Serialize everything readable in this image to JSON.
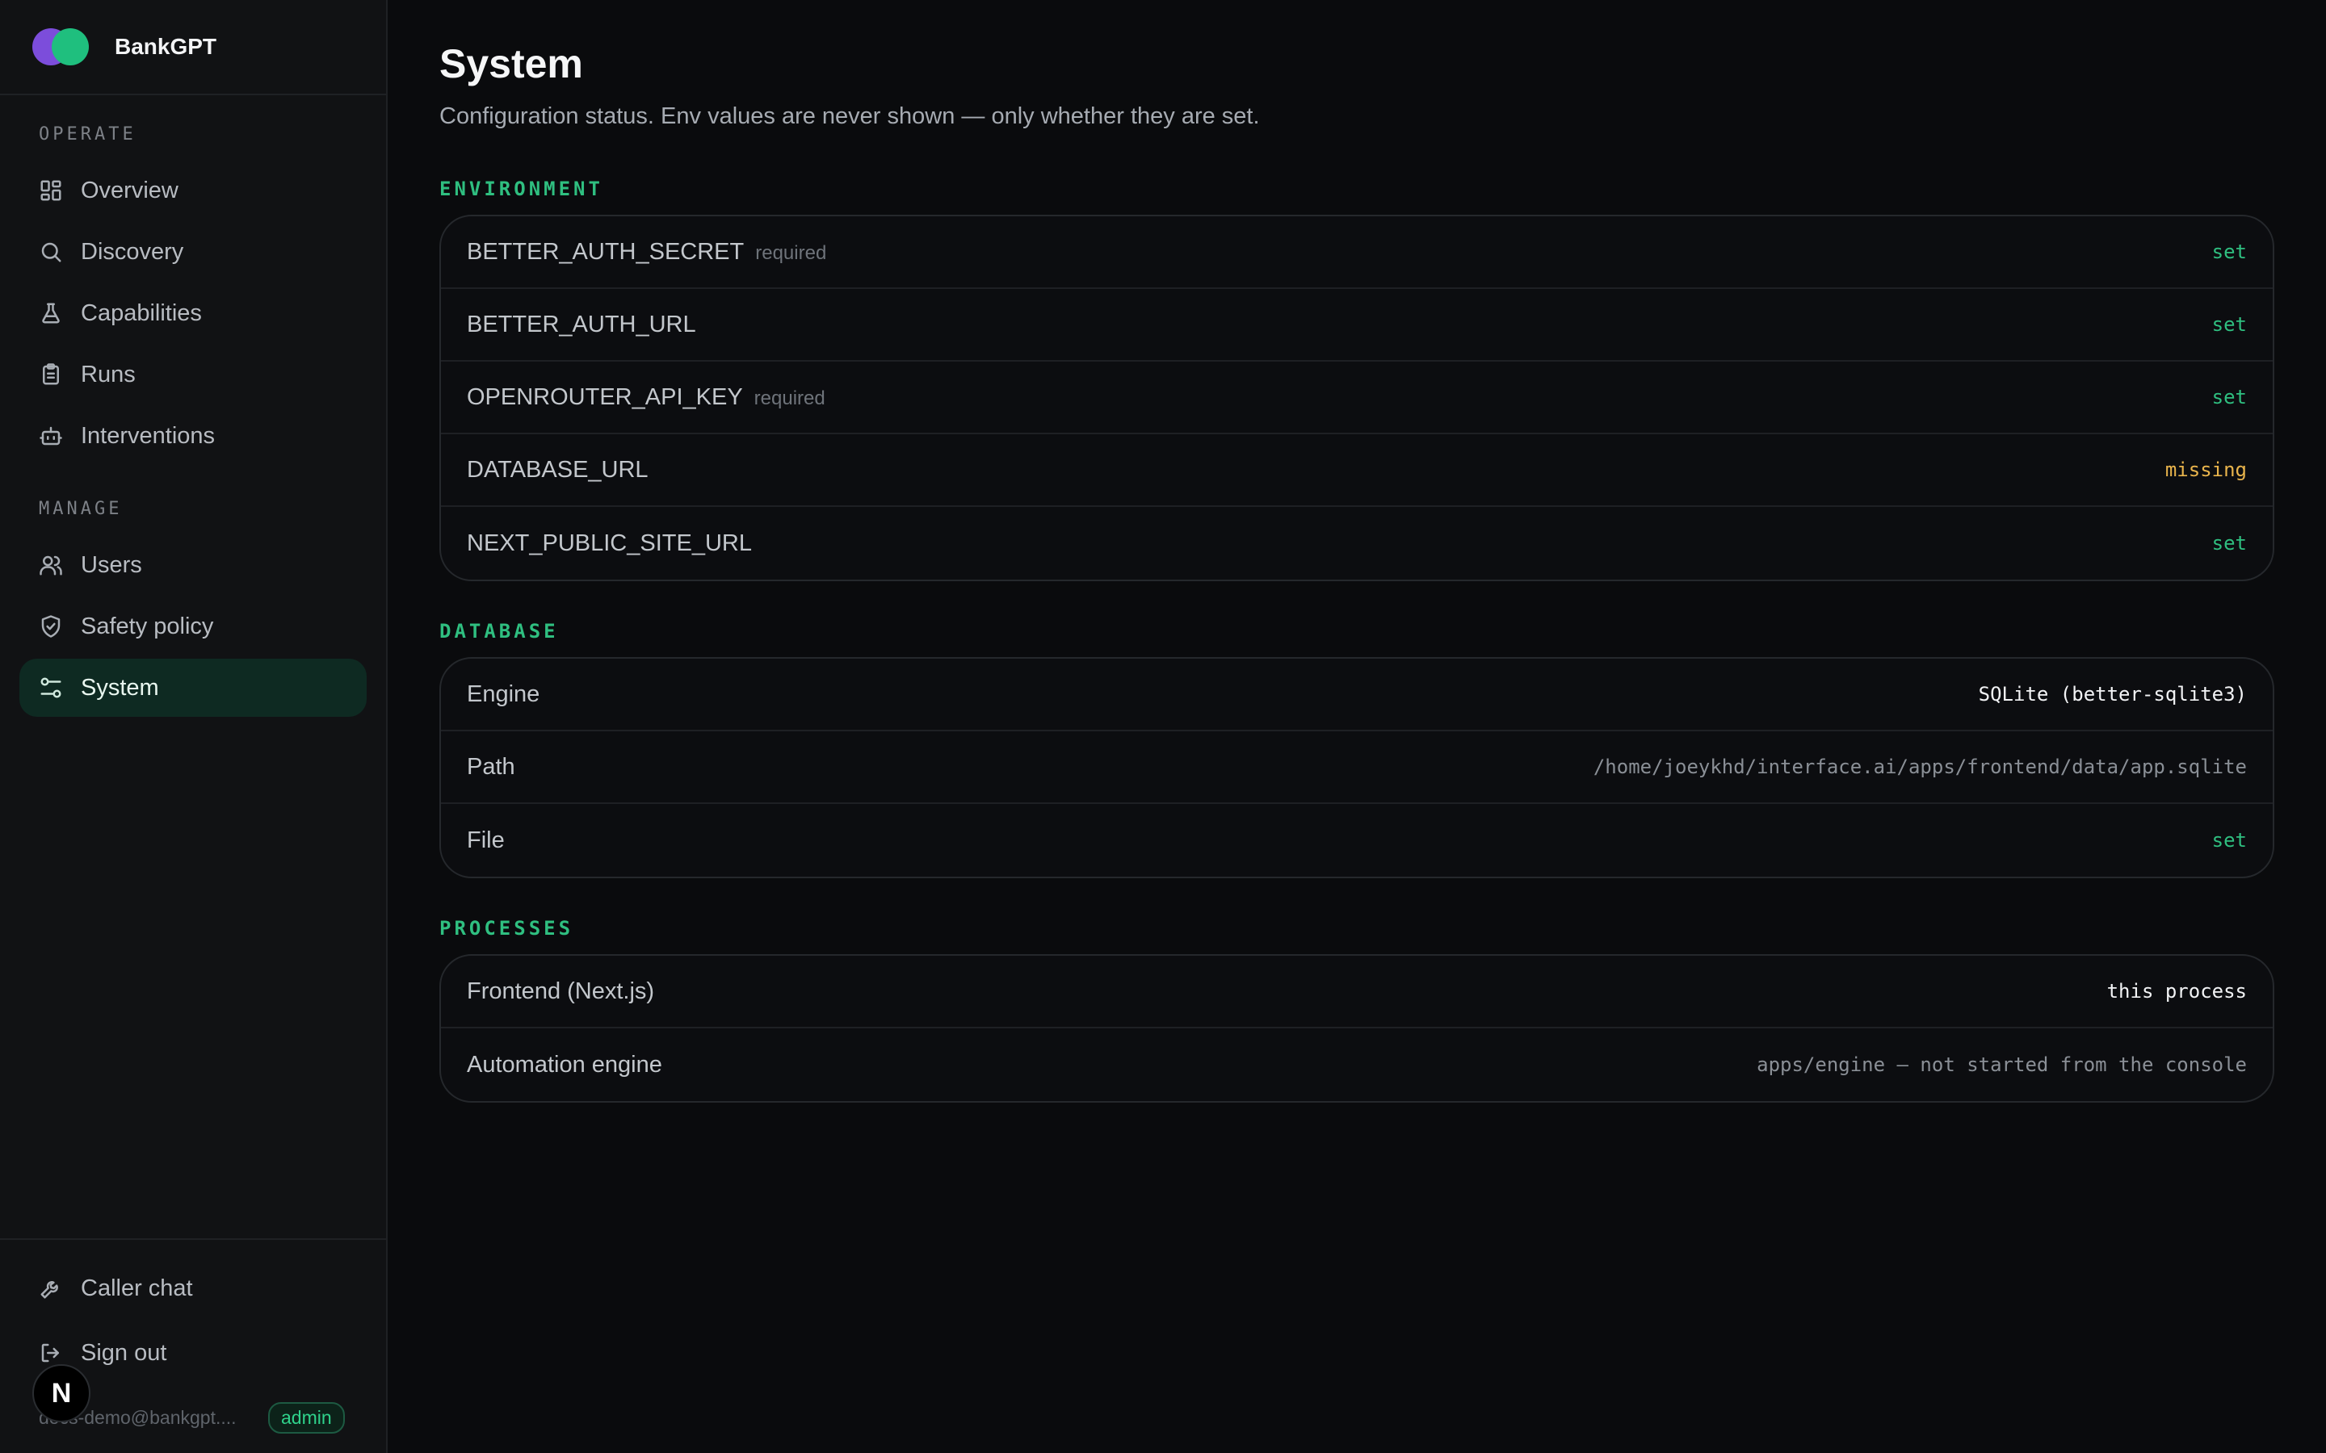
{
  "brand": {
    "name": "BankGPT",
    "colors": {
      "primary": "#7c4ddb",
      "secondary": "#1fbf7e"
    }
  },
  "sidebar": {
    "sections": [
      {
        "label": "OPERATE",
        "items": [
          {
            "label": "Overview",
            "icon": "grid-icon"
          },
          {
            "label": "Discovery",
            "icon": "search-icon"
          },
          {
            "label": "Capabilities",
            "icon": "flask-icon"
          },
          {
            "label": "Runs",
            "icon": "clipboard-icon"
          },
          {
            "label": "Interventions",
            "icon": "bot-icon"
          }
        ]
      },
      {
        "label": "MANAGE",
        "items": [
          {
            "label": "Users",
            "icon": "users-icon"
          },
          {
            "label": "Safety policy",
            "icon": "shield-check-icon"
          },
          {
            "label": "System",
            "icon": "sliders-icon",
            "active": true
          }
        ]
      }
    ],
    "footer": {
      "caller_chat": "Caller chat",
      "sign_out": "Sign out",
      "user_email": "docs-demo@bankgpt....",
      "role_badge": "admin",
      "n_badge": "N"
    }
  },
  "page": {
    "title": "System",
    "description": "Configuration status. Env values are never shown — only whether they are set."
  },
  "environment": {
    "label": "ENVIRONMENT",
    "rows": [
      {
        "key": "BETTER_AUTH_SECRET",
        "tag": "required",
        "value": "set"
      },
      {
        "key": "BETTER_AUTH_URL",
        "tag": "",
        "value": "set"
      },
      {
        "key": "OPENROUTER_API_KEY",
        "tag": "required",
        "value": "set"
      },
      {
        "key": "DATABASE_URL",
        "tag": "",
        "value": "missing"
      },
      {
        "key": "NEXT_PUBLIC_SITE_URL",
        "tag": "",
        "value": "set"
      }
    ]
  },
  "database": {
    "label": "DATABASE",
    "rows": [
      {
        "key": "Engine",
        "value": "SQLite (better-sqlite3)"
      },
      {
        "key": "Path",
        "value": "/home/joeykhd/interface.ai/apps/frontend/data/app.sqlite"
      },
      {
        "key": "File",
        "value": "set"
      }
    ]
  },
  "processes": {
    "label": "PROCESSES",
    "rows": [
      {
        "key": "Frontend (Next.js)",
        "value": "this process"
      },
      {
        "key": "Automation engine",
        "value": "apps/engine — not started from the console"
      }
    ]
  },
  "status_colors": {
    "set": "#2fbf80",
    "missing": "#e9b44c"
  }
}
